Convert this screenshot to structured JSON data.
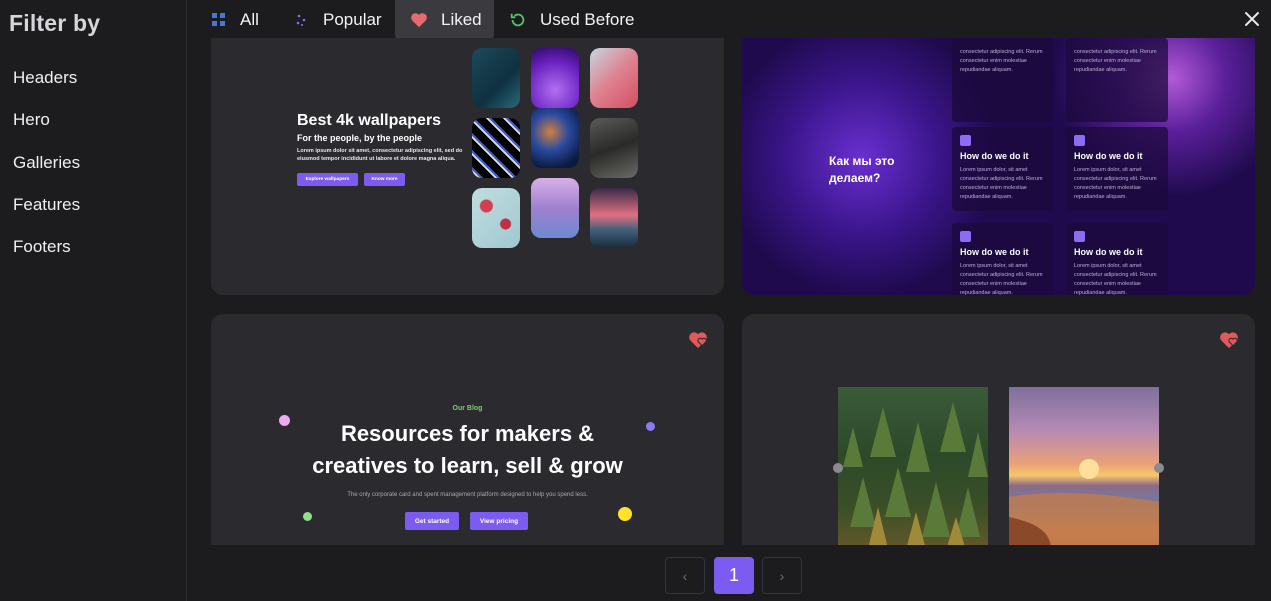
{
  "sidebar": {
    "title": "Filter by",
    "items": [
      {
        "label": "Headers"
      },
      {
        "label": "Hero"
      },
      {
        "label": "Galleries"
      },
      {
        "label": "Features"
      },
      {
        "label": "Footers"
      }
    ]
  },
  "tabs": [
    {
      "label": "All",
      "icon": "grid-icon",
      "active": false
    },
    {
      "label": "Popular",
      "icon": "sparkle-icon",
      "active": false
    },
    {
      "label": "Liked",
      "icon": "heart-icon",
      "active": true
    },
    {
      "label": "Used Before",
      "icon": "history-icon",
      "active": false
    }
  ],
  "colors": {
    "accent": "#7c5cf0",
    "heart": "#e05a5a",
    "used_before_icon": "#58c26b",
    "grid_icon": "#4a74d8"
  },
  "card1": {
    "title": "Best 4k wallpapers",
    "subtitle": "For the people, by the people",
    "body": "Lorem ipsum dolor sit amet, consectetur adipiscing elit, sed do eiusmod tempor incididunt ut labore et dolore magna aliqua.",
    "btn_primary": "Explore wallpapers",
    "btn_secondary": "Know more"
  },
  "card2": {
    "title": "Как мы это делаем?",
    "partial_text": "consectetur adipiscing elit. Rerum consectetur enim molestiae repudiandae aliquam.",
    "features": [
      {
        "title": "How do we do it",
        "body": "Lorem ipsum dolor, sit amet consectetur adipiscing elit. Rerum consectetur enim molestiae repudiandae aliquam."
      },
      {
        "title": "How do we do it",
        "body": "Lorem ipsum dolor, sit amet consectetur adipiscing elit. Rerum consectetur enim molestiae repudiandae aliquam."
      },
      {
        "title": "How do we do it",
        "body": "Lorem ipsum dolor, sit amet consectetur adipiscing elit. Rerum consectetur enim molestiae repudiandae aliquam."
      },
      {
        "title": "How do we do it",
        "body": "Lorem ipsum dolor, sit amet consectetur adipiscing elit. Rerum consectetur enim molestiae repudiandae aliquam."
      }
    ]
  },
  "card3": {
    "eyebrow": "Our Blog",
    "heading_line1": "Resources for makers &",
    "heading_line2": "creatives to learn, sell & grow",
    "paragraph": "The only corporate card and spent management platform designed to help you spend less.",
    "btn_primary": "Get started",
    "btn_secondary": "View pricing"
  },
  "pagination": {
    "prev": "‹",
    "current": "1",
    "next": "›"
  }
}
